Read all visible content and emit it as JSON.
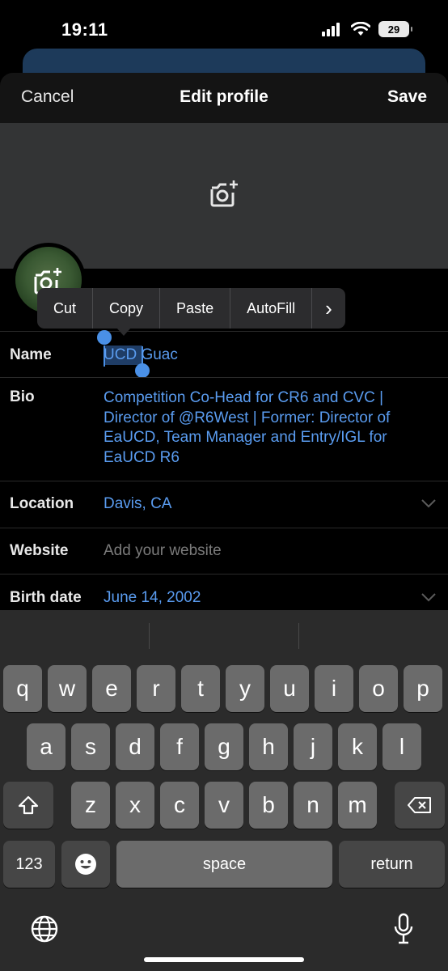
{
  "status_bar": {
    "time": "19:11",
    "battery": "29"
  },
  "nav": {
    "cancel": "Cancel",
    "title": "Edit profile",
    "save": "Save"
  },
  "context_menu": {
    "items": [
      "Cut",
      "Copy",
      "Paste",
      "AutoFill"
    ],
    "more": "›"
  },
  "form": {
    "name": {
      "label": "Name",
      "selected": "UCD",
      "rest": " Guac"
    },
    "bio": {
      "label": "Bio",
      "value": "Competition Co-Head for CR6 and CVC | Director of @R6West | Former: Director of EaUCD, Team Manager and Entry/IGL for EaUCD R6"
    },
    "location": {
      "label": "Location",
      "value": "Davis, CA"
    },
    "website": {
      "label": "Website",
      "placeholder": "Add your website"
    },
    "birth_date": {
      "label": "Birth date",
      "value": "June 14, 2002"
    }
  },
  "keyboard": {
    "row1": [
      "q",
      "w",
      "e",
      "r",
      "t",
      "y",
      "u",
      "i",
      "o",
      "p"
    ],
    "row2": [
      "a",
      "s",
      "d",
      "f",
      "g",
      "h",
      "j",
      "k",
      "l"
    ],
    "row3": [
      "z",
      "x",
      "c",
      "v",
      "b",
      "n",
      "m"
    ],
    "numbers": "123",
    "space": "space",
    "return": "return"
  },
  "icons": [
    "signal-icon",
    "wifi-icon",
    "camera-plus-icon",
    "shift-icon",
    "backspace-icon",
    "emoji-icon",
    "globe-icon",
    "microphone-icon",
    "chevron-down-icon"
  ],
  "colors": {
    "link": "#5a9cf0",
    "selection": "#1f3d66",
    "cursor": "#4a90e6"
  }
}
